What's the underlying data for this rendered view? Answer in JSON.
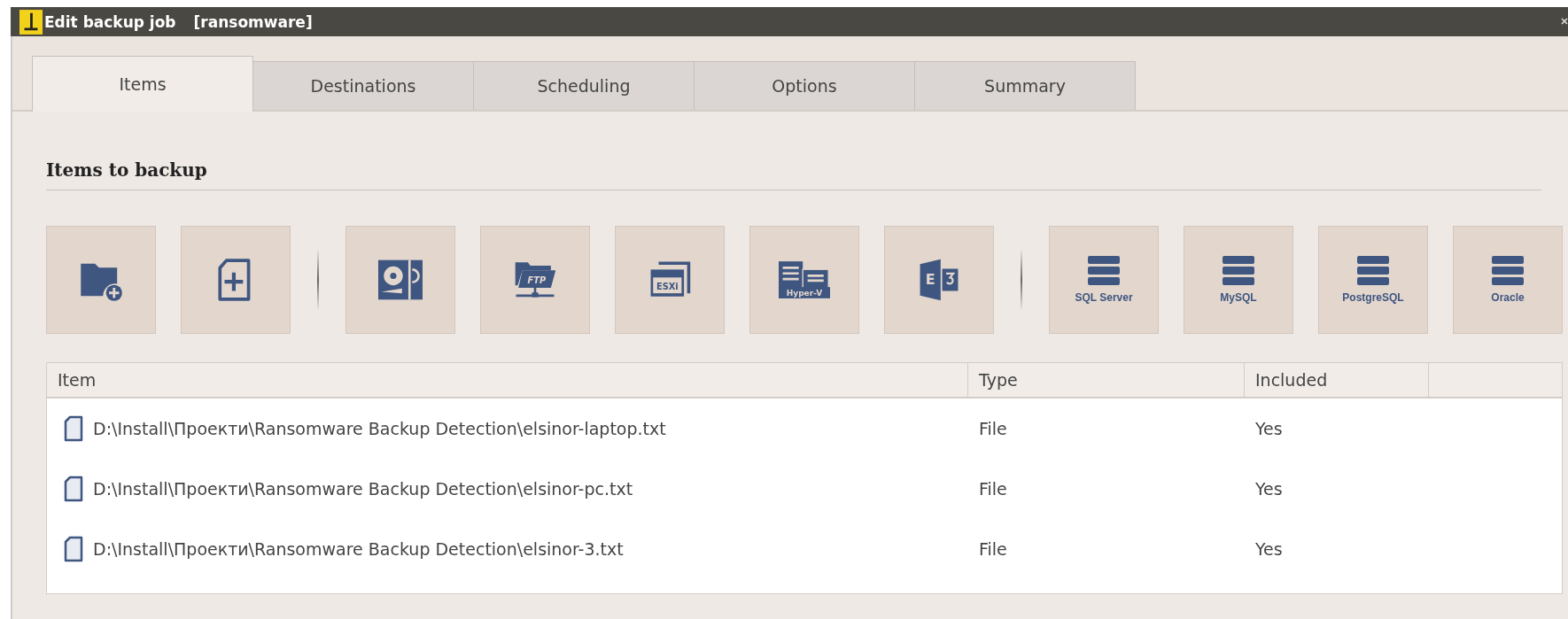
{
  "window": {
    "title": "Edit backup job",
    "subtitle": "[ransomware]"
  },
  "tabs": [
    {
      "label": "Items",
      "selected": true
    },
    {
      "label": "Destinations",
      "selected": false
    },
    {
      "label": "Scheduling",
      "selected": false
    },
    {
      "label": "Options",
      "selected": false
    },
    {
      "label": "Summary",
      "selected": false
    }
  ],
  "section_title": "Items to backup",
  "toolbar": {
    "groups": [
      [
        {
          "kind": "add-folder"
        },
        {
          "kind": "add-file"
        }
      ],
      [
        {
          "kind": "disk-image"
        },
        {
          "kind": "ftp",
          "label": "FTP"
        },
        {
          "kind": "esxi",
          "label": "ESXi"
        },
        {
          "kind": "hyperv",
          "label": "Hyper-V"
        },
        {
          "kind": "exchange",
          "label": "E"
        }
      ],
      [
        {
          "kind": "database",
          "label": "SQL Server"
        },
        {
          "kind": "database",
          "label": "MySQL"
        },
        {
          "kind": "database",
          "label": "PostgreSQL"
        },
        {
          "kind": "database",
          "label": "Oracle"
        }
      ]
    ]
  },
  "table": {
    "columns": [
      "Item",
      "Type",
      "Included"
    ],
    "rows": [
      {
        "item": "D:\\Install\\Проекти\\Ransomware Backup Detection\\elsinor-laptop.txt",
        "type": "File",
        "included": "Yes"
      },
      {
        "item": "D:\\Install\\Проекти\\Ransomware Backup Detection\\elsinor-pc.txt",
        "type": "File",
        "included": "Yes"
      },
      {
        "item": "D:\\Install\\Проекти\\Ransomware Backup Detection\\elsinor-3.txt",
        "type": "File",
        "included": "Yes"
      }
    ]
  }
}
